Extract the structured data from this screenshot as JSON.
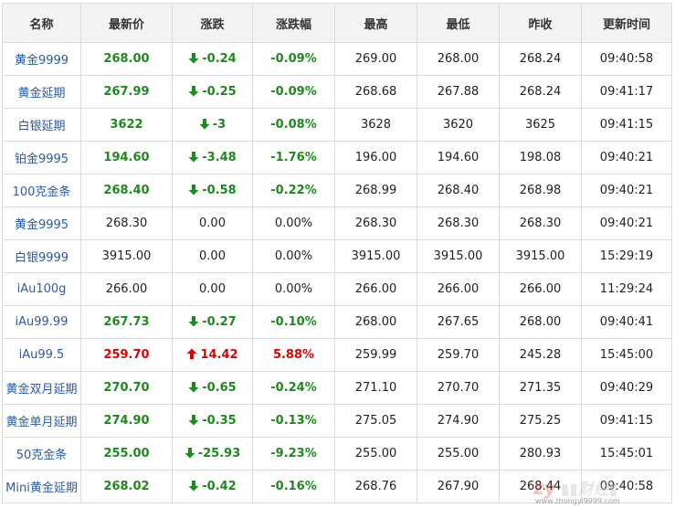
{
  "table": {
    "headers": [
      "名称",
      "最新价",
      "涨跌",
      "涨跌幅",
      "最高",
      "最低",
      "昨收",
      "更新时间"
    ],
    "rows": [
      {
        "name": "黄金9999",
        "price": "268.00",
        "change": "-0.24",
        "pct": "-0.09%",
        "high": "269.00",
        "low": "268.00",
        "prev": "268.24",
        "time": "09:40:58",
        "dir": "down"
      },
      {
        "name": "黄金延期",
        "price": "267.99",
        "change": "-0.25",
        "pct": "-0.09%",
        "high": "268.68",
        "low": "267.88",
        "prev": "268.24",
        "time": "09:41:17",
        "dir": "down"
      },
      {
        "name": "白银延期",
        "price": "3622",
        "change": "-3",
        "pct": "-0.08%",
        "high": "3628",
        "low": "3620",
        "prev": "3625",
        "time": "09:41:15",
        "dir": "down"
      },
      {
        "name": "铂金9995",
        "price": "194.60",
        "change": "-3.48",
        "pct": "-1.76%",
        "high": "196.00",
        "low": "194.60",
        "prev": "198.08",
        "time": "09:40:21",
        "dir": "down"
      },
      {
        "name": "100克金条",
        "price": "268.40",
        "change": "-0.58",
        "pct": "-0.22%",
        "high": "268.99",
        "low": "268.40",
        "prev": "268.98",
        "time": "09:40:21",
        "dir": "down"
      },
      {
        "name": "黄金9995",
        "price": "268.30",
        "change": "0.00",
        "pct": "0.00%",
        "high": "268.30",
        "low": "268.30",
        "prev": "268.30",
        "time": "09:40:21",
        "dir": "flat"
      },
      {
        "name": "白银9999",
        "price": "3915.00",
        "change": "0.00",
        "pct": "0.00%",
        "high": "3915.00",
        "low": "3915.00",
        "prev": "3915.00",
        "time": "15:29:19",
        "dir": "flat"
      },
      {
        "name": "iAu100g",
        "price": "266.00",
        "change": "0.00",
        "pct": "0.00%",
        "high": "266.00",
        "low": "266.00",
        "prev": "266.00",
        "time": "11:29:24",
        "dir": "flat"
      },
      {
        "name": "iAu99.99",
        "price": "267.73",
        "change": "-0.27",
        "pct": "-0.10%",
        "high": "268.00",
        "low": "267.65",
        "prev": "268.00",
        "time": "09:40:41",
        "dir": "down"
      },
      {
        "name": "iAu99.5",
        "price": "259.70",
        "change": "14.42",
        "pct": "5.88%",
        "high": "259.99",
        "low": "259.70",
        "prev": "245.28",
        "time": "15:45:00",
        "dir": "up"
      },
      {
        "name": "黄金双月延期",
        "price": "270.70",
        "change": "-0.65",
        "pct": "-0.24%",
        "high": "271.10",
        "low": "270.70",
        "prev": "271.35",
        "time": "09:40:29",
        "dir": "down"
      },
      {
        "name": "黄金单月延期",
        "price": "274.90",
        "change": "-0.35",
        "pct": "-0.13%",
        "high": "275.05",
        "low": "274.90",
        "prev": "275.25",
        "time": "09:41:15",
        "dir": "down"
      },
      {
        "name": "50克金条",
        "price": "255.00",
        "change": "-25.93",
        "pct": "-9.23%",
        "high": "255.00",
        "low": "255.00",
        "prev": "280.93",
        "time": "15:45:01",
        "dir": "down"
      },
      {
        "name": "Mini黄金延期",
        "price": "268.02",
        "change": "-0.42",
        "pct": "-0.16%",
        "high": "268.76",
        "low": "267.90",
        "prev": "268.44",
        "time": "09:40:58",
        "dir": "down"
      }
    ]
  },
  "colors": {
    "up": "#e00000",
    "down": "#1c8a1c",
    "name_link": "#2a5aa8",
    "header_bg": "#f3f3f3"
  },
  "icons": {
    "down": "arrow-down-icon",
    "up": "arrow-up-icon"
  },
  "watermark": {
    "logo": "中亿财经网",
    "url": "www.zhongyi9999.com"
  }
}
